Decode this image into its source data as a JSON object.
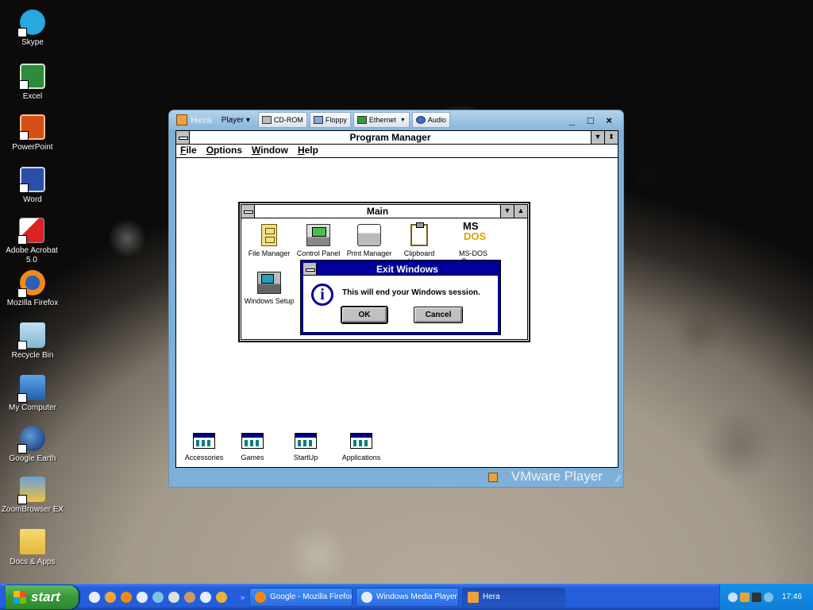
{
  "desktop": {
    "icons": [
      {
        "label": "Skype",
        "icon": "skype-icon"
      },
      {
        "label": "Excel",
        "icon": "excel-icon"
      },
      {
        "label": "PowerPoint",
        "icon": "powerpoint-icon"
      },
      {
        "label": "Word",
        "icon": "word-icon"
      },
      {
        "label": "Adobe Acrobat 5.0",
        "icon": "acrobat-icon"
      },
      {
        "label": "Mozilla Firefox",
        "icon": "firefox-icon"
      },
      {
        "label": "Recycle Bin",
        "icon": "recycle-bin-icon"
      },
      {
        "label": "My Computer",
        "icon": "my-computer-icon"
      },
      {
        "label": "Google Earth",
        "icon": "google-earth-icon"
      },
      {
        "label": "ZoomBrowser EX",
        "icon": "zoombrowser-icon"
      },
      {
        "label": "Docs & Apps",
        "icon": "folder-icon"
      }
    ]
  },
  "vmware": {
    "vm_name": "Hera",
    "player_menu": "Player",
    "devices": [
      {
        "label": "CD-ROM",
        "icon": "cdrom-icon"
      },
      {
        "label": "Floppy",
        "icon": "floppy-icon"
      },
      {
        "label": "Ethernet",
        "icon": "ethernet-icon"
      },
      {
        "label": "Audio",
        "icon": "audio-icon"
      }
    ],
    "window_buttons": "_ □ ×",
    "brand": "VMware Player"
  },
  "progman": {
    "title": "Program Manager",
    "menu": [
      "File",
      "Options",
      "Window",
      "Help"
    ],
    "main_group": {
      "title": "Main",
      "icons": [
        {
          "label": "File Manager",
          "icon": "file-manager-icon"
        },
        {
          "label": "Control Panel",
          "icon": "control-panel-icon"
        },
        {
          "label": "Print Manager",
          "icon": "print-manager-icon"
        },
        {
          "label": "Clipboard Viewer",
          "icon": "clipboard-viewer-icon"
        },
        {
          "label": "MS-DOS Prompt",
          "icon": "ms-dos-icon"
        },
        {
          "label": "Windows Setup",
          "icon": "windows-setup-icon"
        }
      ]
    },
    "minimized_groups": [
      "Accessories",
      "Games",
      "StartUp",
      "Applications"
    ]
  },
  "dialog": {
    "title": "Exit Windows",
    "message": "This will end your Windows session.",
    "ok": "OK",
    "cancel": "Cancel"
  },
  "taskbar": {
    "start": "start",
    "tasks": [
      {
        "label": "Google - Mozilla Firefox",
        "icon": "firefox-icon"
      },
      {
        "label": "Windows Media Player",
        "icon": "media-player-icon"
      },
      {
        "label": "Hera",
        "icon": "vmware-icon"
      }
    ],
    "clock": "17:46"
  },
  "colors": {
    "xp_taskbar": "#245edb",
    "win31_titlebar": "#000099",
    "vmware_frame": "#7fb0d8"
  }
}
